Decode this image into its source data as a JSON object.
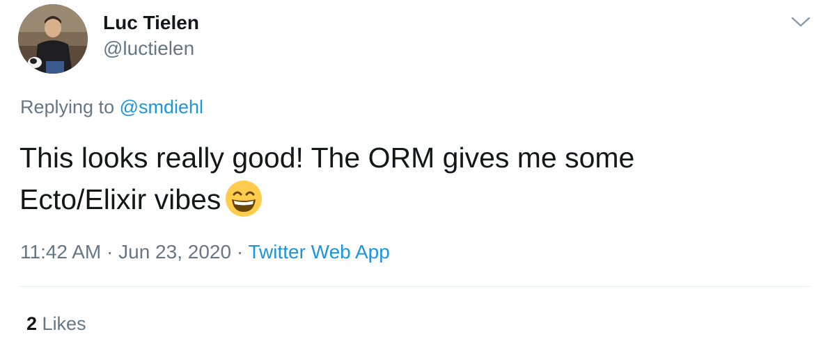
{
  "user": {
    "display_name": "Luc Tielen",
    "handle": "@luctielen"
  },
  "reply": {
    "prefix": "Replying to",
    "mention": "@smdiehl"
  },
  "tweet": {
    "line1": "This looks really good! The ORM gives me some",
    "line2": "Ecto/Elixir vibes",
    "emoji": "grinning-face-with-smiling-eyes"
  },
  "meta": {
    "time": "11:42 AM",
    "separator1": "·",
    "date": "Jun 23, 2020",
    "separator2": "·",
    "source": "Twitter Web App"
  },
  "stats": {
    "likes_count": "2",
    "likes_label": "Likes"
  },
  "icons": {
    "caret": "chevron-down-icon"
  },
  "colors": {
    "link": "#1b95e0",
    "secondary_text": "#657786",
    "primary_text": "#14171a",
    "divider": "#e6ecf0",
    "emoji_face": "#ffcc4d"
  }
}
